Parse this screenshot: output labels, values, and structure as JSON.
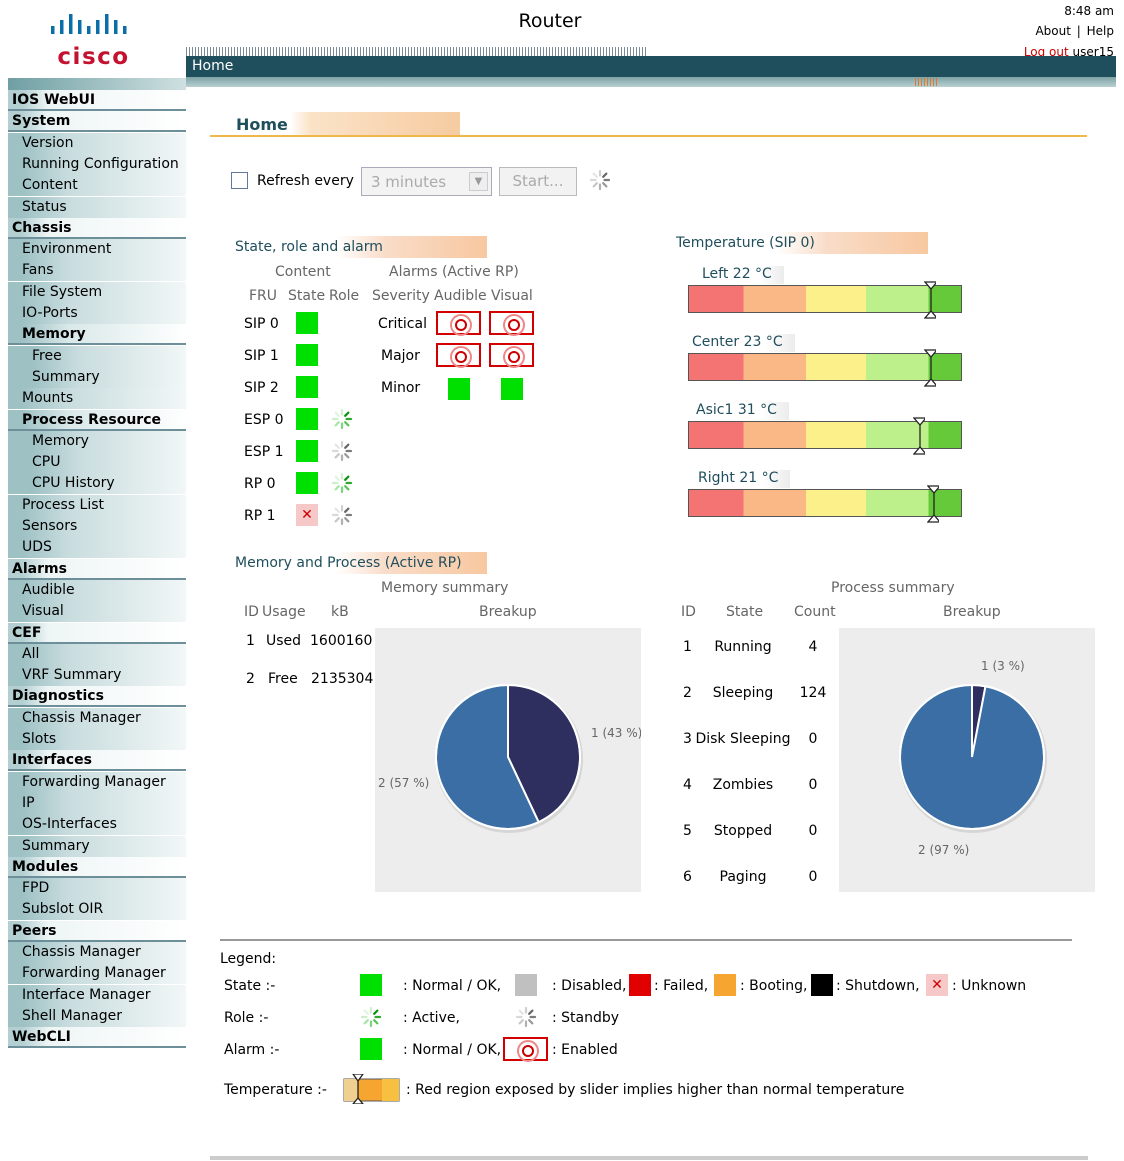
{
  "header": {
    "brand": "cisco",
    "title": "Router",
    "time": "8:48 am",
    "about": "About",
    "separator": "|",
    "help": "Help",
    "logout": "Log out",
    "user": "user15",
    "breadcrumb": "Home"
  },
  "sidebar": {
    "items": [
      {
        "label": "IOS WebUI",
        "kind": "cat"
      },
      {
        "label": "System",
        "kind": "cat"
      },
      {
        "label": "Version",
        "kind": "sub"
      },
      {
        "label": "Running Configuration",
        "kind": "sub"
      },
      {
        "label": "Content",
        "kind": "sub"
      },
      {
        "label": "Status",
        "kind": "sub"
      },
      {
        "label": "Chassis",
        "kind": "cat"
      },
      {
        "label": "Environment",
        "kind": "sub"
      },
      {
        "label": "Fans",
        "kind": "sub"
      },
      {
        "label": "File System",
        "kind": "sub"
      },
      {
        "label": "IO-Ports",
        "kind": "sub"
      },
      {
        "label": "Memory",
        "kind": "subcat"
      },
      {
        "label": "Free",
        "kind": "sub2"
      },
      {
        "label": "Summary",
        "kind": "sub2"
      },
      {
        "label": "Mounts",
        "kind": "sub"
      },
      {
        "label": "Process Resource",
        "kind": "subcat"
      },
      {
        "label": "Memory",
        "kind": "sub2"
      },
      {
        "label": "CPU",
        "kind": "sub2"
      },
      {
        "label": "CPU History",
        "kind": "sub2"
      },
      {
        "label": "Process List",
        "kind": "sub"
      },
      {
        "label": "Sensors",
        "kind": "sub"
      },
      {
        "label": "UDS",
        "kind": "sub"
      },
      {
        "label": "Alarms",
        "kind": "cat"
      },
      {
        "label": "Audible",
        "kind": "sub"
      },
      {
        "label": "Visual",
        "kind": "sub"
      },
      {
        "label": "CEF",
        "kind": "cat"
      },
      {
        "label": "All",
        "kind": "sub"
      },
      {
        "label": "VRF Summary",
        "kind": "sub"
      },
      {
        "label": "Diagnostics",
        "kind": "cat"
      },
      {
        "label": "Chassis Manager",
        "kind": "sub"
      },
      {
        "label": "Slots",
        "kind": "sub"
      },
      {
        "label": "Interfaces",
        "kind": "cat"
      },
      {
        "label": "Forwarding Manager",
        "kind": "sub"
      },
      {
        "label": "IP",
        "kind": "sub"
      },
      {
        "label": "OS-Interfaces",
        "kind": "sub"
      },
      {
        "label": "Summary",
        "kind": "sub"
      },
      {
        "label": "Modules",
        "kind": "cat"
      },
      {
        "label": "FPD",
        "kind": "sub"
      },
      {
        "label": "Subslot OIR",
        "kind": "sub"
      },
      {
        "label": "Peers",
        "kind": "cat"
      },
      {
        "label": "Chassis Manager",
        "kind": "sub"
      },
      {
        "label": "Forwarding Manager",
        "kind": "sub"
      },
      {
        "label": "Interface Manager",
        "kind": "sub"
      },
      {
        "label": "Shell Manager",
        "kind": "sub"
      },
      {
        "label": "WebCLI",
        "kind": "cat"
      }
    ]
  },
  "page": {
    "title": "Home",
    "refresh_label": "Refresh every",
    "refresh_value": "3 minutes",
    "start_label": "Start..."
  },
  "state": {
    "heading": "State, role and alarm",
    "content_header": "Content",
    "alarms_header": "Alarms (Active RP)",
    "col_fru": "FRU",
    "col_state": "State",
    "col_role": "Role",
    "col_severity": "Severity",
    "col_audible": "Audible",
    "col_visual": "Visual",
    "frus": [
      {
        "name": "SIP 0",
        "state": "ok",
        "role": ""
      },
      {
        "name": "SIP 1",
        "state": "ok",
        "role": ""
      },
      {
        "name": "SIP 2",
        "state": "ok",
        "role": ""
      },
      {
        "name": "ESP 0",
        "state": "ok",
        "role": "active"
      },
      {
        "name": "ESP 1",
        "state": "ok",
        "role": "standby"
      },
      {
        "name": "RP 0",
        "state": "ok",
        "role": "active"
      },
      {
        "name": "RP 1",
        "state": "unknown",
        "role": "standby"
      }
    ],
    "alarms": [
      {
        "severity": "Critical",
        "audible": "enabled",
        "visual": "enabled"
      },
      {
        "severity": "Major",
        "audible": "enabled",
        "visual": "enabled"
      },
      {
        "severity": "Minor",
        "audible": "ok",
        "visual": "ok"
      }
    ]
  },
  "temperature": {
    "heading": "Temperature (SIP 0)",
    "sensors": [
      {
        "label": "Left 22 °C",
        "level": 0.89
      },
      {
        "label": "Center 23 °C",
        "level": 0.89
      },
      {
        "label": "Asic1 31 °C",
        "level": 0.85
      },
      {
        "label": "Right 21 °C",
        "level": 0.9
      }
    ]
  },
  "memproc": {
    "heading": "Memory and Process (Active RP)",
    "memory": {
      "title": "Memory summary",
      "col_id": "ID",
      "col_usage": "Usage",
      "col_kb": "kB",
      "col_breakup": "Breakup",
      "rows": [
        {
          "id": "1",
          "usage": "Used",
          "kb": "1600160"
        },
        {
          "id": "2",
          "usage": "Free",
          "kb": "2135304"
        }
      ]
    },
    "process": {
      "title": "Process summary",
      "col_id": "ID",
      "col_state": "State",
      "col_count": "Count",
      "col_breakup": "Breakup",
      "rows": [
        {
          "id": "1",
          "state": "Running",
          "count": "4"
        },
        {
          "id": "2",
          "state": "Sleeping",
          "count": "124"
        },
        {
          "id": "3",
          "state": "Disk Sleeping",
          "count": "0"
        },
        {
          "id": "4",
          "state": "Zombies",
          "count": "0"
        },
        {
          "id": "5",
          "state": "Stopped",
          "count": "0"
        },
        {
          "id": "6",
          "state": "Paging",
          "count": "0"
        }
      ]
    }
  },
  "legend": {
    "title": "Legend:",
    "state_label": "State :-",
    "state_items": [
      ": Normal / OK,",
      ": Disabled,",
      ": Failed,",
      ": Booting,",
      ": Shutdown,",
      ": Unknown"
    ],
    "role_label": "Role :-",
    "role_items": [
      ": Active,",
      ": Standby"
    ],
    "alarm_label": "Alarm :-",
    "alarm_items": [
      ": Normal / OK,",
      ": Enabled"
    ],
    "temp_label": "Temperature :-",
    "temp_text": ": Red region exposed by slider implies higher than normal temperature"
  },
  "colors": {
    "ok": "#00e000",
    "disabled": "#c0c0c0",
    "failed": "#e00000",
    "booting": "#f7a531",
    "shutdown": "#000000",
    "unknown": "#f6c8c8",
    "nav": "#1f4e5c",
    "pie_primary": "#3a6ea5",
    "pie_secondary": "#2e2f5e"
  },
  "chart_data": [
    {
      "type": "pie",
      "title": "Memory summary",
      "labels": [
        "1",
        "2"
      ],
      "values": [
        43,
        57
      ],
      "slice_labels": [
        "1 (43 %)",
        "2 (57 %)"
      ]
    },
    {
      "type": "pie",
      "title": "Process summary",
      "labels": [
        "1",
        "2"
      ],
      "values": [
        3,
        97
      ],
      "slice_labels": [
        "1 (3 %)",
        "2 (97 %)"
      ]
    }
  ]
}
